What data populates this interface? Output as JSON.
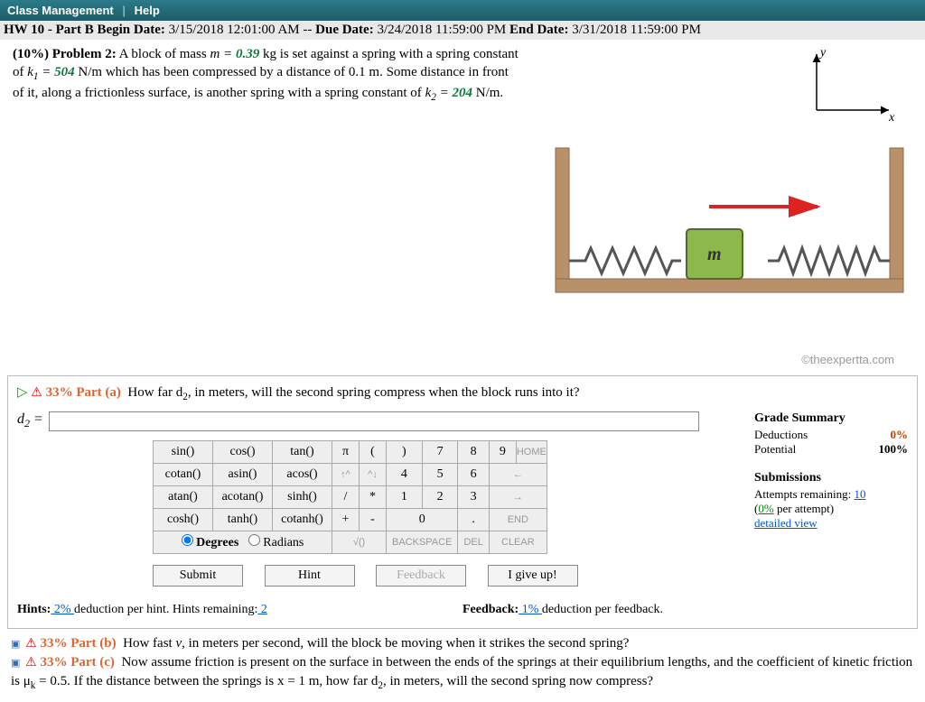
{
  "topbar": {
    "class_mgmt": "Class Management",
    "help": "Help"
  },
  "hw": {
    "title_prefix": "HW 10 - Part B",
    "begin_lbl": "Begin Date:",
    "begin": "3/15/2018 12:01:00 AM",
    "due_lbl": "Due Date:",
    "due": "3/24/2018 11:59:00 PM",
    "end_lbl": "End Date:",
    "end": "3/31/2018 11:59:00 PM"
  },
  "problem": {
    "pct": "(10%) Problem 2:",
    "txt1": "A block of mass ",
    "m_eq": "m = ",
    "m_val": "0.39",
    "txt2": " kg is set against a spring with a spring constant of ",
    "k1_eq": "k",
    "k1_sub": "1",
    "eq": " = ",
    "k1_val": "504",
    "txt3": " N/m which has been compressed by a distance of 0.1 m. Some distance in front of it, along a frictionless surface, is another spring with a spring constant of ",
    "k2_eq": "k",
    "k2_sub": "2",
    "k2_val": "204",
    "txt4": " N/m."
  },
  "copyright": "©theexpertta.com",
  "part_a": {
    "pct": "33%",
    "label": "Part (a)",
    "q": "How far d",
    "q_sub": "2",
    "q2": ", in meters, will the second spring compress when the block runs into it?",
    "var": "d",
    "var_sub": "2",
    "eq": " ="
  },
  "keypad": {
    "rows": [
      [
        "sin()",
        "cos()",
        "tan()"
      ],
      [
        "cotan()",
        "asin()",
        "acos()"
      ],
      [
        "atan()",
        "acotan()",
        "sinh()"
      ],
      [
        "cosh()",
        "tanh()",
        "cotanh()"
      ]
    ],
    "nums": [
      [
        "π",
        "(",
        ")",
        "7",
        "8",
        "9",
        "HOME"
      ],
      [
        "↑^",
        "^↓",
        "4",
        "5",
        "6",
        "←"
      ],
      [
        "/",
        "*",
        "1",
        "2",
        "3",
        "→"
      ],
      [
        "+",
        "-",
        "0",
        ".",
        "END"
      ]
    ],
    "deg": "Degrees",
    "rad": "Radians",
    "sqrt": "√()",
    "back": "BACKSPACE",
    "del": "DEL",
    "clear": "CLEAR"
  },
  "actions": {
    "submit": "Submit",
    "hint": "Hint",
    "feedback": "Feedback",
    "giveup": "I give up!"
  },
  "grade": {
    "title": "Grade Summary",
    "ded_lbl": "Deductions",
    "ded": "0%",
    "pot_lbl": "Potential",
    "pot": "100%",
    "sub_title": "Submissions",
    "att_lbl": "Attempts remaining:",
    "att": "10",
    "per": "(",
    "per_link": "0%",
    "per2": " per attempt)",
    "detail": "detailed view"
  },
  "hints": {
    "h_lbl": "Hints:",
    "h_link": " 2% ",
    "h_txt": " deduction per hint. Hints remaining:",
    "h_rem": " 2",
    "f_lbl": "Feedback:",
    "f_link": " 1% ",
    "f_txt": " deduction per feedback."
  },
  "part_b": {
    "pct": "33%",
    "label": "Part (b)",
    "txt": "How fast v, in meters per second, will the block be moving when it strikes the second spring?"
  },
  "part_c": {
    "pct": "33%",
    "label": "Part (c)",
    "txt1": "Now assume friction is present on the surface in between the ends of the springs at their equilibrium lengths, and the coefficient of kinetic friction is μ",
    "mu_sub": "k",
    "txt2": " = 0.5. If the distance between the springs is x = 1 m, how far d",
    "d_sub": "2",
    "txt3": ", in meters, will the second spring now compress?"
  }
}
